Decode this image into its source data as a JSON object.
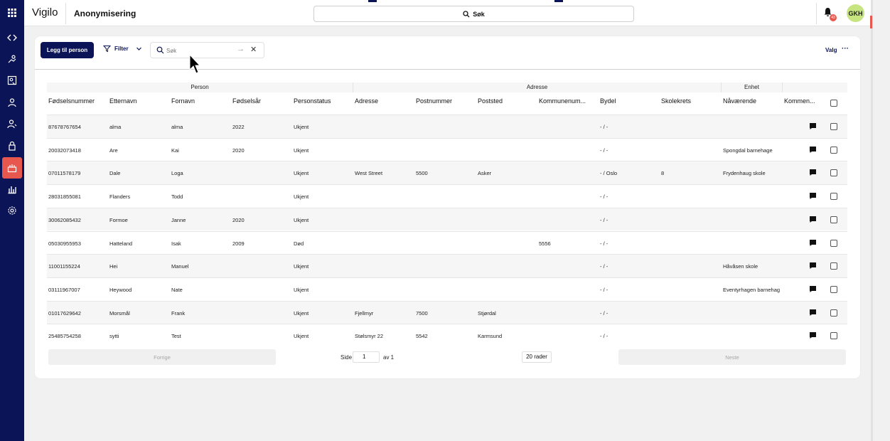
{
  "app": {
    "brand": "Vigilo",
    "page_title": "Anonymisering"
  },
  "header": {
    "search_label": "Søk",
    "notification_count": "43",
    "avatar_initials": "GKH"
  },
  "rail_icons": [
    "apps-grid-icon",
    "code-icon",
    "people-route-icon",
    "contact-card-icon",
    "person-icon",
    "person-outline-icon",
    "lock-icon",
    "anonymize-icon",
    "bar-chart-icon",
    "settings-icon"
  ],
  "toolbar": {
    "add_person_label": "Legg til person",
    "filter_label": "Filter",
    "search_placeholder": "Søk",
    "valg_label": "Valg",
    "more_label": "···"
  },
  "table": {
    "groups": {
      "person": "Person",
      "adresse": "Adresse",
      "enhet": "Enhet"
    },
    "columns": [
      "Fødselsnummer",
      "Etternavn",
      "Fornavn",
      "Fødselsår",
      "Personstatus",
      "Adresse",
      "Postnummer",
      "Poststed",
      "Kommunenum...",
      "Bydel",
      "Skolekrets",
      "Nåværende",
      "Kommen..."
    ],
    "rows": [
      [
        "87678767654",
        "alma",
        "alma",
        "2022",
        "Ukjent",
        "",
        "",
        "",
        "",
        "- / -",
        "",
        ""
      ],
      [
        "20032073418",
        "Are",
        "Kai",
        "2020",
        "Ukjent",
        "",
        "",
        "",
        "",
        "- / -",
        "",
        "Spongdal barnehage"
      ],
      [
        "07011578179",
        "Dale",
        "Loga",
        "",
        "Ukjent",
        "West Street",
        "5500",
        "Asker",
        "",
        "- / Oslo",
        "8",
        "Frydenhaug skole"
      ],
      [
        "28031855081",
        "Flanders",
        "Todd",
        "",
        "Ukjent",
        "",
        "",
        "",
        "",
        "- / -",
        "",
        ""
      ],
      [
        "30062085432",
        "Formoe",
        "Janne",
        "2020",
        "Ukjent",
        "",
        "",
        "",
        "",
        "- / -",
        "",
        ""
      ],
      [
        "05030955953",
        "Hatteland",
        "Isak",
        "2009",
        "Død",
        "",
        "",
        "",
        "5556",
        "- / -",
        "",
        ""
      ],
      [
        "11001155224",
        "Hei",
        "Manuel",
        "",
        "Ukjent",
        "",
        "",
        "",
        "",
        "- / -",
        "",
        "Håvåsen skole"
      ],
      [
        "03111967007",
        "Heywood",
        "Nate",
        "",
        "Ukjent",
        "",
        "",
        "",
        "",
        "- / -",
        "",
        "Eventyrhagen barnehag"
      ],
      [
        "01017629642",
        "Morsmål",
        "Frank",
        "",
        "Ukjent",
        "Fjellmyr",
        "7500",
        "Stjørdal",
        "",
        "- / -",
        "",
        ""
      ],
      [
        "25485754258",
        "sytti",
        "Test",
        "",
        "Ukjent",
        "Stølsmyr 22",
        "5542",
        "Karmsund",
        "",
        "- / -",
        "",
        ""
      ]
    ]
  },
  "pagination": {
    "prev_label": "Forrige",
    "page_label": "Side",
    "page_value": "1",
    "of_label": "av 1",
    "rows_label": "20 rader",
    "next_label": "Neste"
  },
  "colors": {
    "navy": "#0b1456",
    "accent_red": "#e8574d",
    "avatar_green": "#c6e480"
  }
}
